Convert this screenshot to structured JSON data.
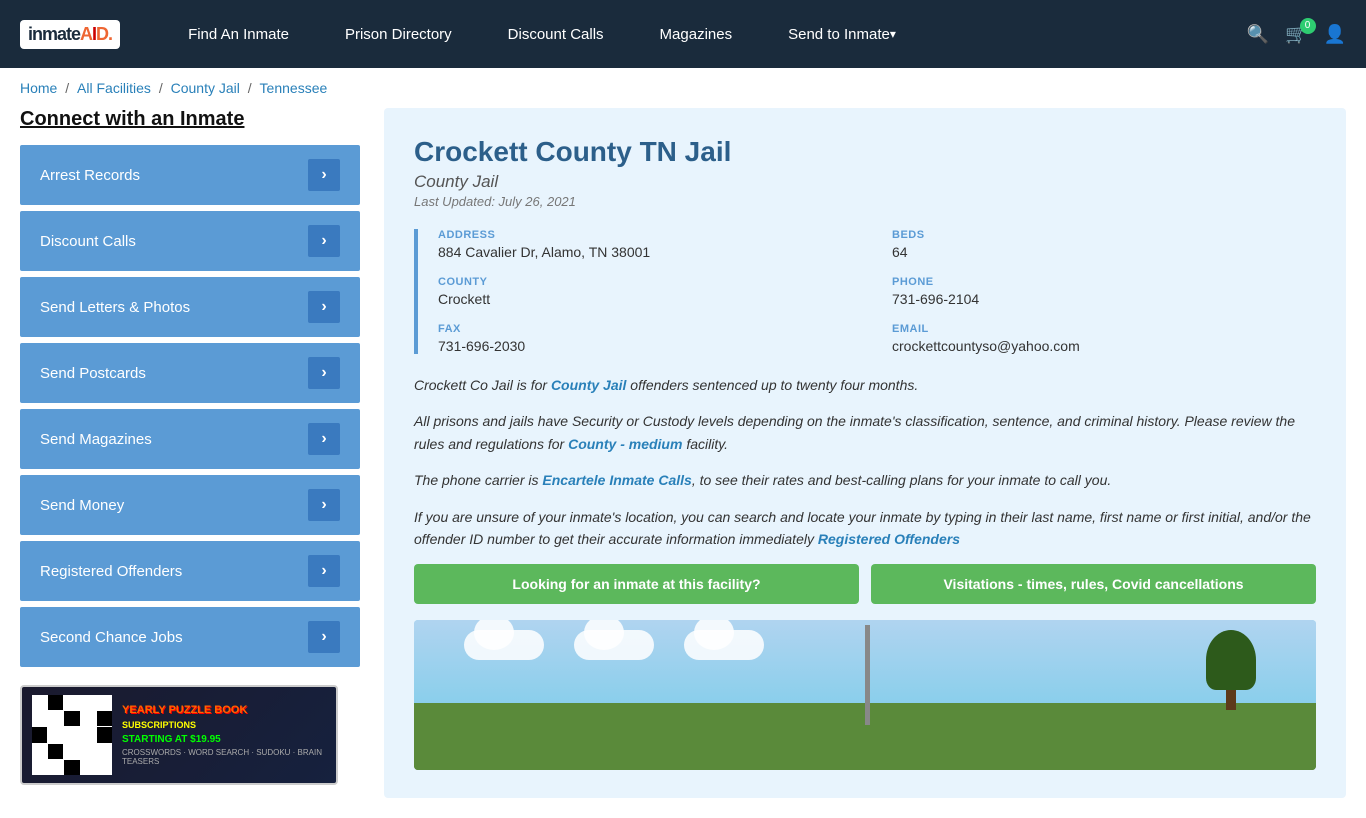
{
  "nav": {
    "logo_text": "inmateAID",
    "links": [
      {
        "label": "Find An Inmate",
        "dropdown": false
      },
      {
        "label": "Prison Directory",
        "dropdown": false
      },
      {
        "label": "Discount Calls",
        "dropdown": false
      },
      {
        "label": "Magazines",
        "dropdown": false
      },
      {
        "label": "Send to Inmate",
        "dropdown": true
      }
    ],
    "cart_count": "0"
  },
  "breadcrumb": {
    "items": [
      "Home",
      "All Facilities",
      "County Jail",
      "Tennessee"
    ]
  },
  "sidebar": {
    "title": "Connect with an Inmate",
    "menu_items": [
      "Arrest Records",
      "Discount Calls",
      "Send Letters & Photos",
      "Send Postcards",
      "Send Magazines",
      "Send Money",
      "Registered Offenders",
      "Second Chance Jobs"
    ]
  },
  "ad": {
    "title": "YEARLY PUZZLE BOOK",
    "subtitle": "SUBSCRIPTIONS",
    "price": "STARTING AT $19.95",
    "types": "CROSSWORDS · WORD SEARCH · SUDOKU · BRAIN TEASERS"
  },
  "facility": {
    "title": "Crockett County TN Jail",
    "type": "County Jail",
    "updated": "Last Updated: July 26, 2021",
    "address_label": "ADDRESS",
    "address_value": "884 Cavalier Dr, Alamo, TN 38001",
    "beds_label": "BEDS",
    "beds_value": "64",
    "county_label": "COUNTY",
    "county_value": "Crockett",
    "phone_label": "PHONE",
    "phone_value": "731-696-2104",
    "fax_label": "FAX",
    "fax_value": "731-696-2030",
    "email_label": "EMAIL",
    "email_value": "crockettcountyso@yahoo.com",
    "desc1": "Crockett Co Jail is for County Jail offenders sentenced up to twenty four months.",
    "desc2": "All prisons and jails have Security or Custody levels depending on the inmate's classification, sentence, and criminal history. Please review the rules and regulations for County - medium facility.",
    "desc3": "The phone carrier is Encartele Inmate Calls, to see their rates and best-calling plans for your inmate to call you.",
    "desc4": "If you are unsure of your inmate's location, you can search and locate your inmate by typing in their last name, first name or first initial, and/or the offender ID number to get their accurate information immediately Registered Offenders",
    "btn1": "Looking for an inmate at this facility?",
    "btn2": "Visitations - times, rules, Covid cancellations"
  }
}
